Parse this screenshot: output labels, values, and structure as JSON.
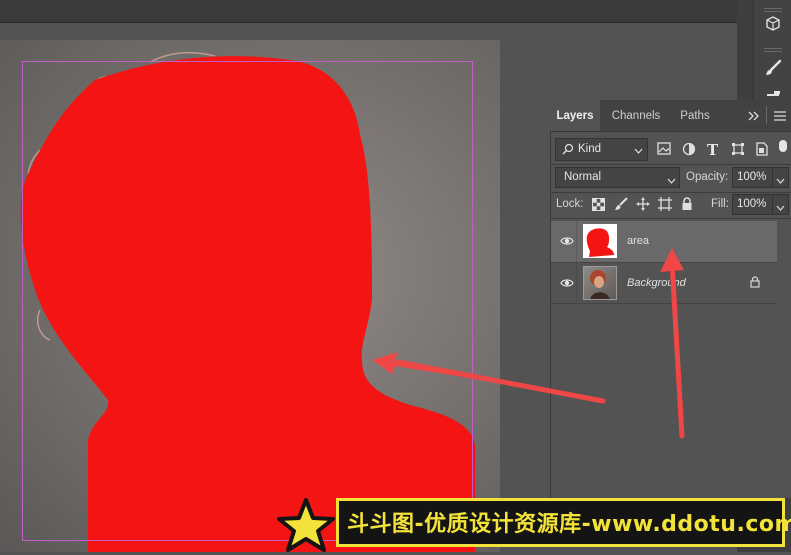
{
  "tabs": {
    "layers": "Layers",
    "channels": "Channels",
    "paths": "Paths"
  },
  "filter": {
    "label": "Kind"
  },
  "blend": {
    "mode": "Normal",
    "opacity_label": "Opacity:",
    "opacity_value": "100%"
  },
  "lock": {
    "label": "Lock:",
    "fill_label": "Fill:",
    "fill_value": "100%"
  },
  "layers": [
    {
      "name": "area",
      "selected": true
    },
    {
      "name": "Background",
      "italic": true,
      "locked": true
    }
  ],
  "watermark": {
    "text": "斗斗图-优质设计资源库-www.ddotu.com"
  },
  "colors": {
    "mask_red": "#f41414",
    "selection_frame": "#c25ec6",
    "arrow_red": "#ef4646",
    "watermark_yellow": "#f3e23a"
  },
  "icons": [
    "cube-icon",
    "brush-icon",
    "brush-settings-icon",
    "search-icon",
    "chevron-down-icon",
    "image-filter-icon",
    "adjustment-filter-icon",
    "type-filter-icon",
    "shape-filter-icon",
    "smart-object-filter-icon",
    "lock-transparent-icon",
    "lock-paint-icon",
    "lock-position-icon",
    "lock-artboard-icon",
    "lock-all-icon",
    "eye-icon",
    "lock-icon",
    "panel-menu-icon",
    "collapse-icon",
    "star-icon"
  ]
}
